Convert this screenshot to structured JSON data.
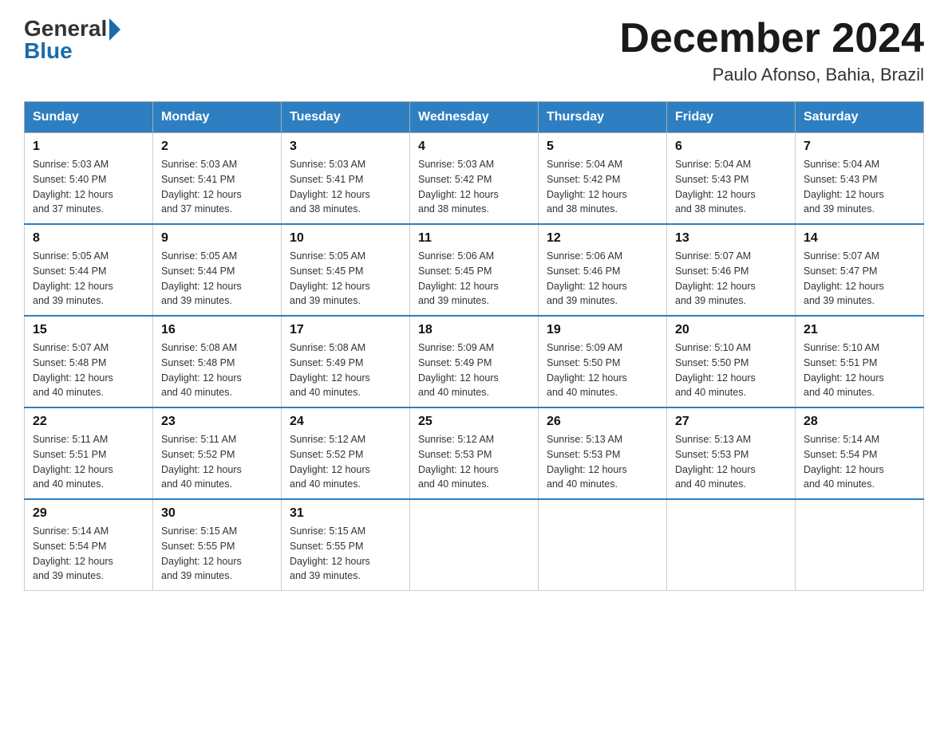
{
  "logo": {
    "general": "General",
    "blue": "Blue"
  },
  "title": "December 2024",
  "location": "Paulo Afonso, Bahia, Brazil",
  "days_of_week": [
    "Sunday",
    "Monday",
    "Tuesday",
    "Wednesday",
    "Thursday",
    "Friday",
    "Saturday"
  ],
  "weeks": [
    [
      {
        "day": "1",
        "sunrise": "5:03 AM",
        "sunset": "5:40 PM",
        "daylight": "12 hours and 37 minutes."
      },
      {
        "day": "2",
        "sunrise": "5:03 AM",
        "sunset": "5:41 PM",
        "daylight": "12 hours and 37 minutes."
      },
      {
        "day": "3",
        "sunrise": "5:03 AM",
        "sunset": "5:41 PM",
        "daylight": "12 hours and 38 minutes."
      },
      {
        "day": "4",
        "sunrise": "5:03 AM",
        "sunset": "5:42 PM",
        "daylight": "12 hours and 38 minutes."
      },
      {
        "day": "5",
        "sunrise": "5:04 AM",
        "sunset": "5:42 PM",
        "daylight": "12 hours and 38 minutes."
      },
      {
        "day": "6",
        "sunrise": "5:04 AM",
        "sunset": "5:43 PM",
        "daylight": "12 hours and 38 minutes."
      },
      {
        "day": "7",
        "sunrise": "5:04 AM",
        "sunset": "5:43 PM",
        "daylight": "12 hours and 39 minutes."
      }
    ],
    [
      {
        "day": "8",
        "sunrise": "5:05 AM",
        "sunset": "5:44 PM",
        "daylight": "12 hours and 39 minutes."
      },
      {
        "day": "9",
        "sunrise": "5:05 AM",
        "sunset": "5:44 PM",
        "daylight": "12 hours and 39 minutes."
      },
      {
        "day": "10",
        "sunrise": "5:05 AM",
        "sunset": "5:45 PM",
        "daylight": "12 hours and 39 minutes."
      },
      {
        "day": "11",
        "sunrise": "5:06 AM",
        "sunset": "5:45 PM",
        "daylight": "12 hours and 39 minutes."
      },
      {
        "day": "12",
        "sunrise": "5:06 AM",
        "sunset": "5:46 PM",
        "daylight": "12 hours and 39 minutes."
      },
      {
        "day": "13",
        "sunrise": "5:07 AM",
        "sunset": "5:46 PM",
        "daylight": "12 hours and 39 minutes."
      },
      {
        "day": "14",
        "sunrise": "5:07 AM",
        "sunset": "5:47 PM",
        "daylight": "12 hours and 39 minutes."
      }
    ],
    [
      {
        "day": "15",
        "sunrise": "5:07 AM",
        "sunset": "5:48 PM",
        "daylight": "12 hours and 40 minutes."
      },
      {
        "day": "16",
        "sunrise": "5:08 AM",
        "sunset": "5:48 PM",
        "daylight": "12 hours and 40 minutes."
      },
      {
        "day": "17",
        "sunrise": "5:08 AM",
        "sunset": "5:49 PM",
        "daylight": "12 hours and 40 minutes."
      },
      {
        "day": "18",
        "sunrise": "5:09 AM",
        "sunset": "5:49 PM",
        "daylight": "12 hours and 40 minutes."
      },
      {
        "day": "19",
        "sunrise": "5:09 AM",
        "sunset": "5:50 PM",
        "daylight": "12 hours and 40 minutes."
      },
      {
        "day": "20",
        "sunrise": "5:10 AM",
        "sunset": "5:50 PM",
        "daylight": "12 hours and 40 minutes."
      },
      {
        "day": "21",
        "sunrise": "5:10 AM",
        "sunset": "5:51 PM",
        "daylight": "12 hours and 40 minutes."
      }
    ],
    [
      {
        "day": "22",
        "sunrise": "5:11 AM",
        "sunset": "5:51 PM",
        "daylight": "12 hours and 40 minutes."
      },
      {
        "day": "23",
        "sunrise": "5:11 AM",
        "sunset": "5:52 PM",
        "daylight": "12 hours and 40 minutes."
      },
      {
        "day": "24",
        "sunrise": "5:12 AM",
        "sunset": "5:52 PM",
        "daylight": "12 hours and 40 minutes."
      },
      {
        "day": "25",
        "sunrise": "5:12 AM",
        "sunset": "5:53 PM",
        "daylight": "12 hours and 40 minutes."
      },
      {
        "day": "26",
        "sunrise": "5:13 AM",
        "sunset": "5:53 PM",
        "daylight": "12 hours and 40 minutes."
      },
      {
        "day": "27",
        "sunrise": "5:13 AM",
        "sunset": "5:53 PM",
        "daylight": "12 hours and 40 minutes."
      },
      {
        "day": "28",
        "sunrise": "5:14 AM",
        "sunset": "5:54 PM",
        "daylight": "12 hours and 40 minutes."
      }
    ],
    [
      {
        "day": "29",
        "sunrise": "5:14 AM",
        "sunset": "5:54 PM",
        "daylight": "12 hours and 39 minutes."
      },
      {
        "day": "30",
        "sunrise": "5:15 AM",
        "sunset": "5:55 PM",
        "daylight": "12 hours and 39 minutes."
      },
      {
        "day": "31",
        "sunrise": "5:15 AM",
        "sunset": "5:55 PM",
        "daylight": "12 hours and 39 minutes."
      },
      null,
      null,
      null,
      null
    ]
  ],
  "labels": {
    "sunrise": "Sunrise:",
    "sunset": "Sunset:",
    "daylight": "Daylight:"
  }
}
